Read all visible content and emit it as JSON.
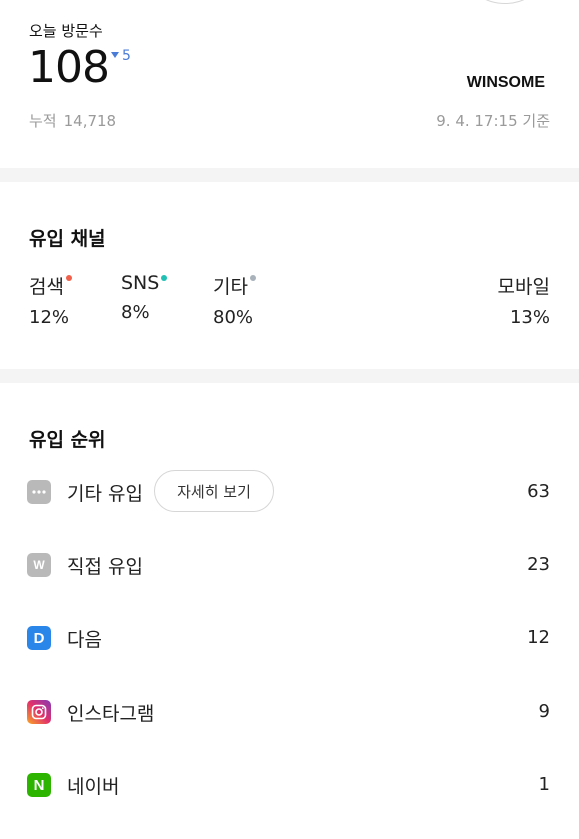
{
  "visitors": {
    "today_label": "오늘 방문수",
    "today_count": "108",
    "delta": "5",
    "blog_name": "WINSOME",
    "cumulative_label": "누적",
    "cumulative_value": "14,718",
    "basis_time": "9. 4. 17:15 기준"
  },
  "channels": {
    "title": "유입 채널",
    "items": [
      {
        "name": "검색",
        "percent": "12%",
        "dot_color": "#f0604a"
      },
      {
        "name": "SNS",
        "percent": "8%",
        "dot_color": "#20c0b4"
      },
      {
        "name": "기타",
        "percent": "80%",
        "dot_color": "#a9b2bb"
      },
      {
        "name": "모바일",
        "percent": "13%"
      }
    ]
  },
  "ranking": {
    "title": "유입 순위",
    "detail_button": "자세히 보기",
    "items": [
      {
        "label": "기타 유입",
        "count": "63",
        "icon": "more-dots-icon",
        "color": "#b9b9b9"
      },
      {
        "label": "직접 유입",
        "count": "23",
        "icon": "direct-w-icon",
        "color": "#b9b9b9"
      },
      {
        "label": "다음",
        "count": "12",
        "icon": "daum-d-icon",
        "color": "#2a86e8"
      },
      {
        "label": "인스타그램",
        "count": "9",
        "icon": "instagram-icon",
        "color": "#c13584"
      },
      {
        "label": "네이버",
        "count": "1",
        "icon": "naver-n-icon",
        "color": "#2db400"
      }
    ]
  }
}
